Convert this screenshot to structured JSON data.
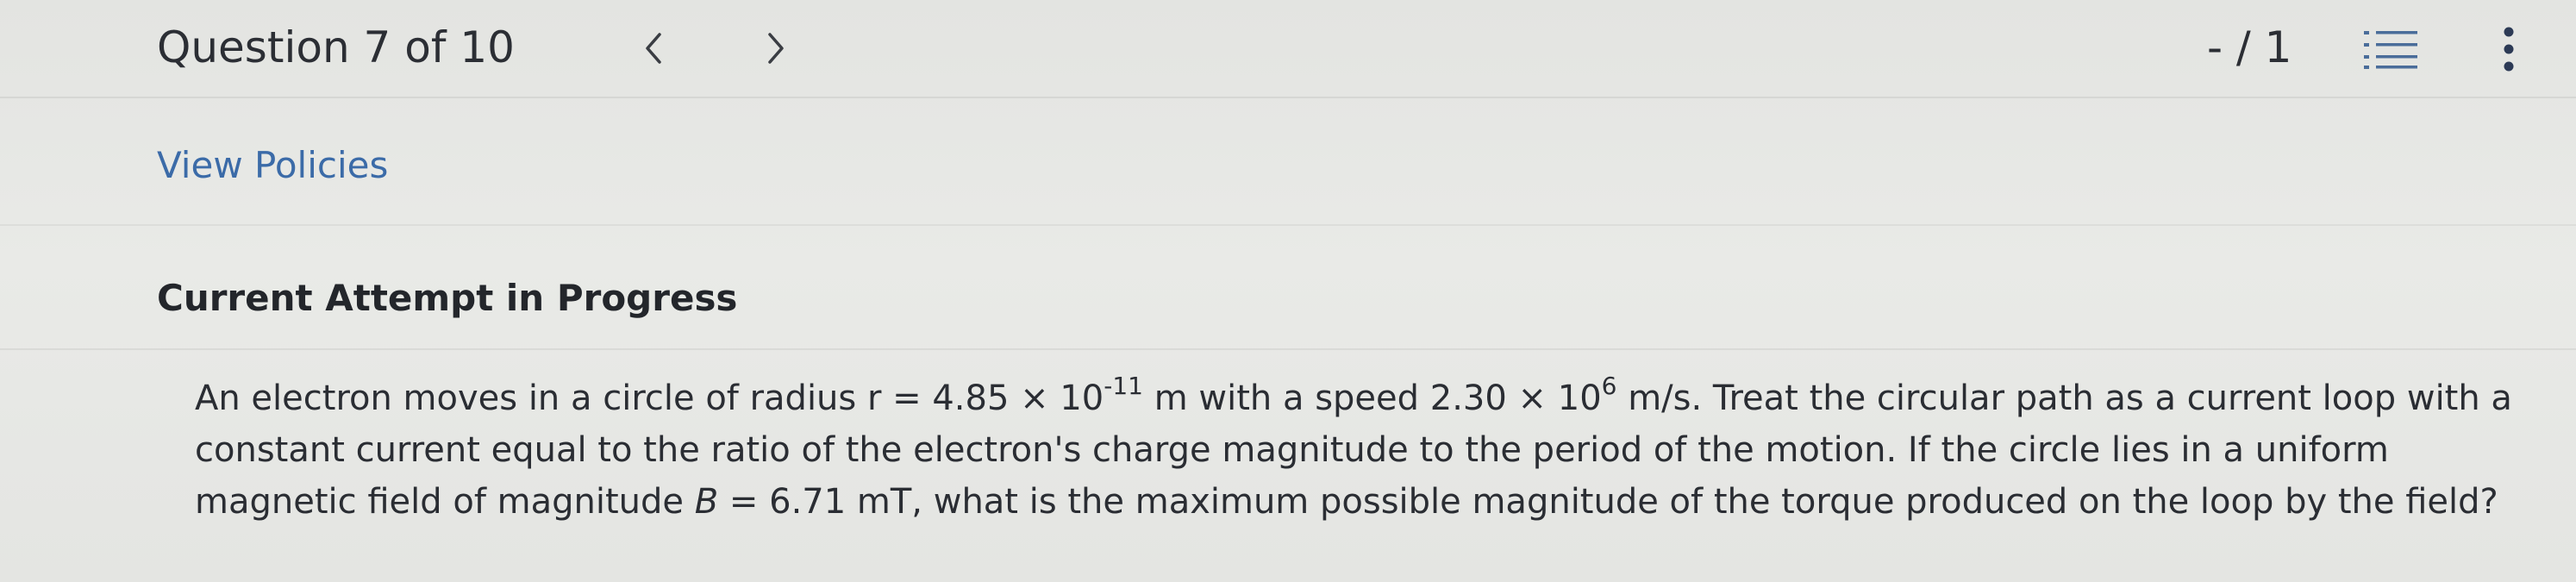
{
  "header": {
    "question_counter": "Question 7 of 10",
    "prev_glyph": "<",
    "next_glyph": ">",
    "score": "- / 1",
    "list_icon": "list-icon",
    "more_icon": "more-vertical-icon"
  },
  "links": {
    "view_policies": "View Policies"
  },
  "status": {
    "attempt": "Current Attempt in Progress"
  },
  "question": {
    "l1_a": "An electron moves in a circle of radius r = 4.85 × 10",
    "l1_exp1": "-11",
    "l1_b": " m with a speed 2.30 × 10",
    "l1_exp2": "6",
    "l1_c": " m/s. Treat the circular path as a current loop with a",
    "l2": "constant current equal to the ratio of the electron's charge magnitude to the period of the motion. If the circle lies in a uniform",
    "l3_a": "magnetic field of magnitude ",
    "l3_var": "B",
    "l3_b": " = 6.71 mT, what is the maximum possible magnitude of the torque produced on the loop by the field?"
  },
  "colors": {
    "background": "#e6e7e4",
    "link": "#3b6ba8",
    "text": "#2a2d33"
  }
}
